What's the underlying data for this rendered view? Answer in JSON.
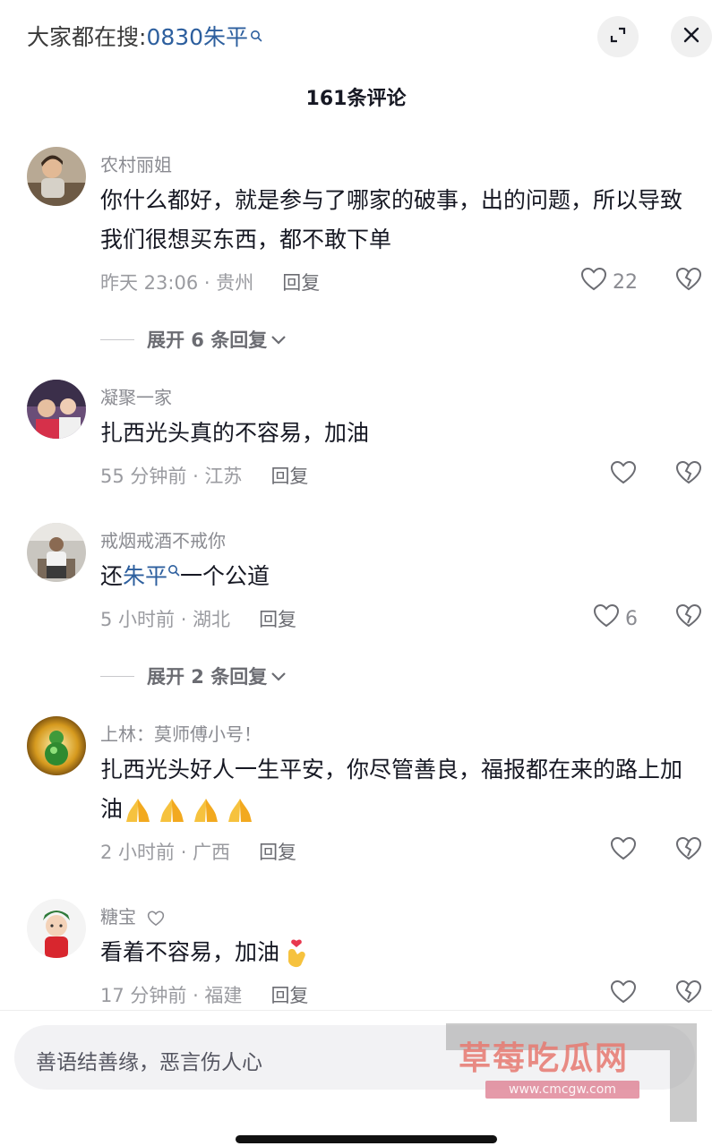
{
  "header": {
    "search_prefix": "大家都在搜:",
    "search_keyword": "0830朱平",
    "comment_count": "161条评论"
  },
  "comments": [
    {
      "username": "农村丽姐",
      "text": "你什么都好，就是参与了哪家的破事，出的问题，所以导致我们很想买东西，都不敢下单",
      "time_location": "昨天 23:06 · 贵州",
      "reply": "回复",
      "likes": "22",
      "expand": "展开 6 条回复"
    },
    {
      "username": "凝聚一家",
      "text": "扎西光头真的不容易，加油",
      "time_location": "55 分钟前 · 江苏",
      "reply": "回复"
    },
    {
      "username": "戒烟戒酒不戒你",
      "text_before": "还",
      "text_link": "朱平",
      "text_after": "一个公道",
      "time_location": "5 小时前 · 湖北",
      "reply": "回复",
      "likes": "6",
      "expand": "展开 2 条回复"
    },
    {
      "username": "上林：莫师傅小号！",
      "text": "扎西光头好人一生平安，你尽管善良，福报都在来的路上加油",
      "time_location": "2 小时前 · 广西",
      "reply": "回复"
    },
    {
      "username": "糖宝",
      "text": "看着不容易，加油",
      "time_location": "17 分钟前 · 福建",
      "reply": "回复"
    }
  ],
  "input": {
    "placeholder": "善语结善缘，恶言伤人心"
  },
  "watermark": {
    "title": "草莓吃瓜网",
    "url": "www.cmcgw.com"
  },
  "icons": {
    "expand": "expand-icon",
    "close": "close-icon",
    "like": "heart-icon",
    "dislike": "broken-heart-icon",
    "keyword": "search-icon"
  },
  "colors": {
    "link": "#2d5f9e",
    "secondary": "#8a8b91"
  }
}
